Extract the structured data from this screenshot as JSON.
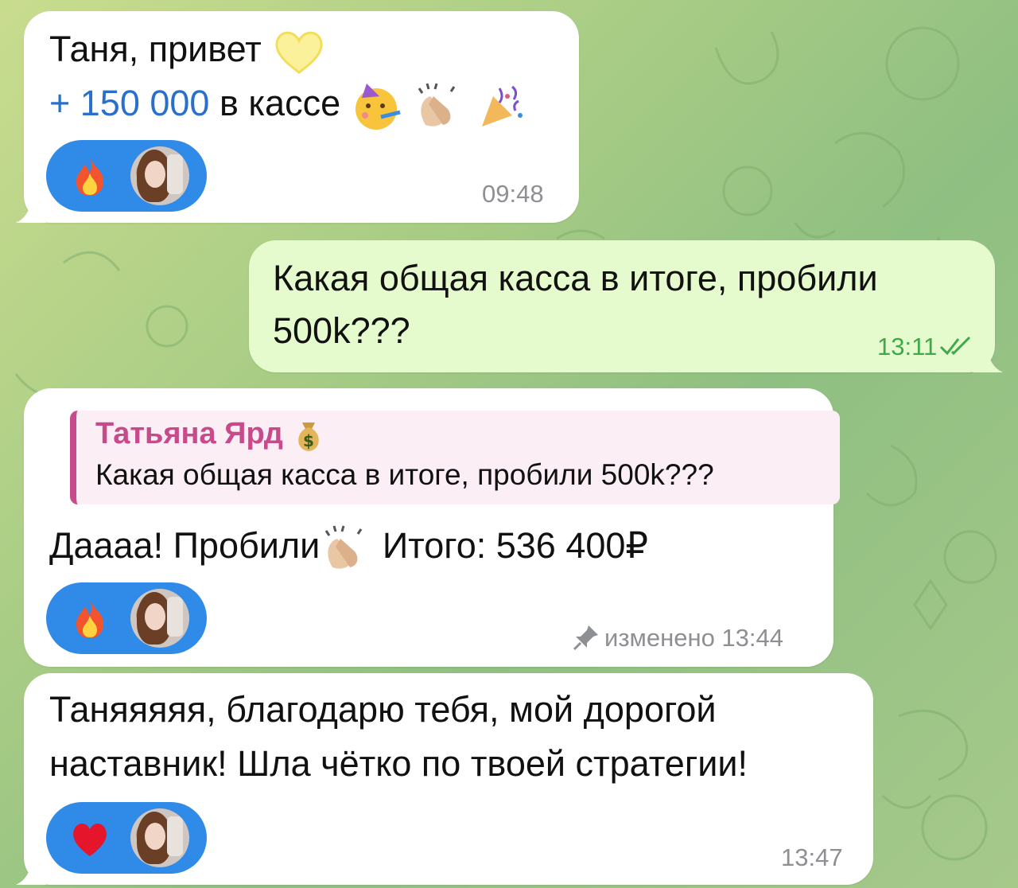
{
  "messages": [
    {
      "direction": "incoming",
      "line1": "Таня, привет",
      "line1_emoji": "yellow-heart-icon",
      "amount": "+ 150 000",
      "line2_rest": "в кассе",
      "line2_emojis": [
        "partying-face-icon",
        "clapping-hands-icon",
        "party-popper-icon"
      ],
      "reaction_emoji": "fire-icon",
      "time": "09:48"
    },
    {
      "direction": "outgoing",
      "line1": "Какая общая касса в итоге, пробили",
      "line2": "500k???",
      "time": "13:11",
      "status_icon": "double-check-icon"
    },
    {
      "direction": "incoming",
      "reply_name": "Татьяна Ярд",
      "reply_name_emoji": "money-bag-icon",
      "reply_text": "Какая общая касса в итоге, пробили 500k???",
      "text_before": "Даааа! Пробили",
      "text_emoji": "clapping-hands-icon",
      "text_after": "Итого: 536 400₽",
      "reaction_emoji": "fire-icon",
      "edited_icon": "pin-icon",
      "edited_label": "изменено 13:44"
    },
    {
      "direction": "incoming",
      "line1": "Таняяяяя, благодарю тебя, мой дорогой",
      "line2": "наставник! Шла чётко по твоей стратегии!",
      "reaction_emoji": "red-heart-icon",
      "time": "13:47"
    }
  ],
  "colors": {
    "incoming_bubble": "#ffffff",
    "outgoing_bubble": "#e6fbcd",
    "reaction_pill": "#2f8ae8",
    "amount_link": "#2a6fc9",
    "reply_accent": "#c74a8a",
    "outgoing_time": "#3fa84a"
  }
}
